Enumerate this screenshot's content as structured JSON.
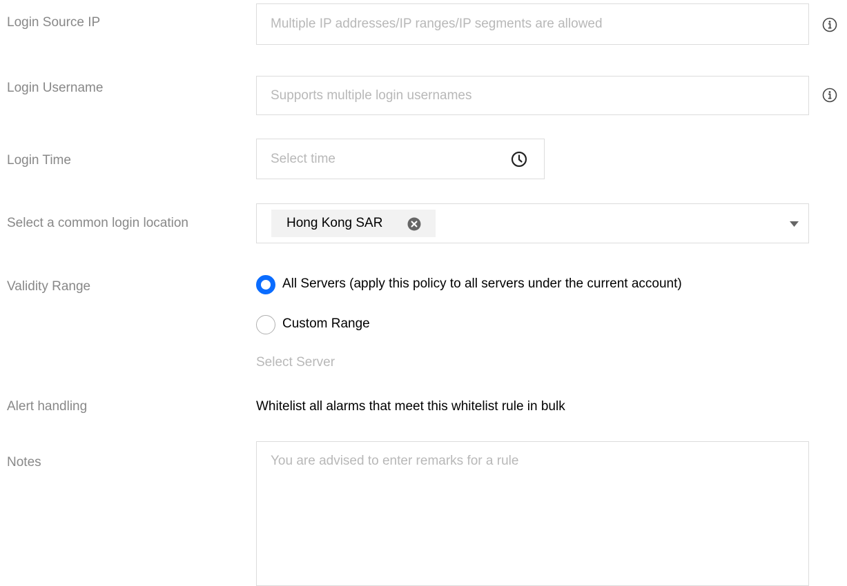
{
  "form": {
    "source_ip": {
      "label": "Login Source IP",
      "value": "",
      "placeholder": "Multiple IP addresses/IP ranges/IP segments are allowed",
      "icon": "info-icon"
    },
    "username": {
      "label": "Login Username",
      "value": "",
      "placeholder": "Supports multiple login usernames",
      "icon": "info-icon"
    },
    "login_time": {
      "label": "Login Time",
      "value": "",
      "placeholder": "Select time",
      "icon": "clock-icon"
    },
    "location": {
      "label": "Select a common login location",
      "tags": [
        {
          "text": "Hong Kong SAR",
          "icon": "close-circle-icon"
        }
      ],
      "icon": "caret-down-icon"
    },
    "validity": {
      "label": "Validity Range",
      "options": [
        {
          "label": "All Servers (apply this policy to all servers under the current account)",
          "checked": true
        },
        {
          "label": "Custom Range",
          "checked": false
        }
      ],
      "select_server": "Select Server"
    },
    "alert": {
      "label": "Alert handling",
      "text": "Whitelist all alarms that meet this whitelist rule in bulk"
    },
    "notes": {
      "label": "Notes",
      "value": "",
      "placeholder": "You are advised to enter remarks for a rule"
    }
  },
  "colors": {
    "label": "#888888",
    "placeholder": "#b8b8b8",
    "border": "#dcdcdc",
    "accent": "#0a6cff",
    "tag_bg": "#f2f2f2"
  }
}
